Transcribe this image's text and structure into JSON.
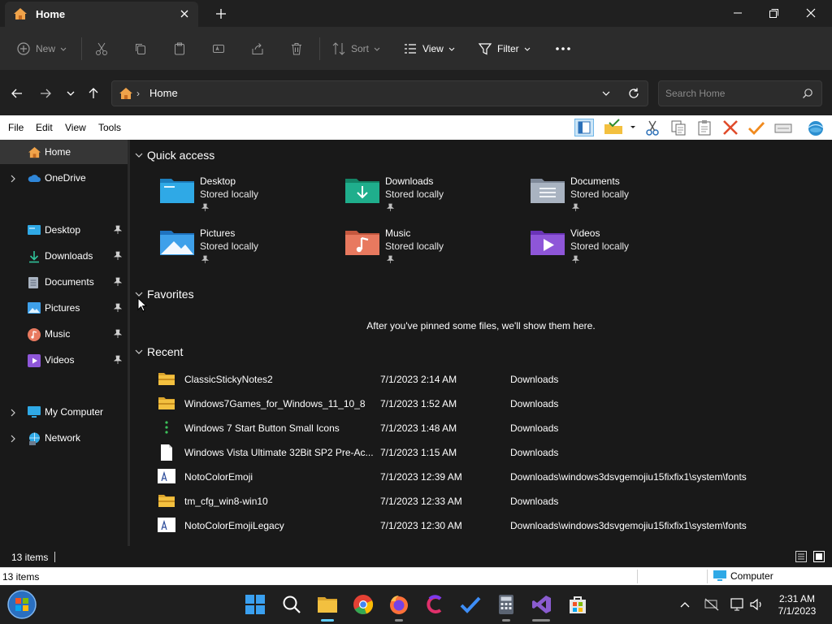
{
  "window": {
    "tab_title": "Home",
    "tab_icon": "home-icon"
  },
  "commandbar": {
    "new": "New",
    "sort": "Sort",
    "view": "View",
    "filter": "Filter",
    "more": "..."
  },
  "address": {
    "path": "Home",
    "search_placeholder": "Search Home"
  },
  "menubar": {
    "file": "File",
    "edit": "Edit",
    "view": "View",
    "tools": "Tools"
  },
  "nav": {
    "home": "Home",
    "onedrive": "OneDrive",
    "desktop": "Desktop",
    "downloads": "Downloads",
    "documents": "Documents",
    "pictures": "Pictures",
    "music": "Music",
    "videos": "Videos",
    "my_computer": "My Computer",
    "network": "Network"
  },
  "sections": {
    "quick_access": "Quick access",
    "favorites": "Favorites",
    "recent": "Recent",
    "favorites_empty": "After you've pinned some files, we'll show them here."
  },
  "quick_access": [
    {
      "name": "Desktop",
      "status": "Stored locally",
      "color": "#2fa9e6"
    },
    {
      "name": "Downloads",
      "status": "Stored locally",
      "color": "#1fae8c"
    },
    {
      "name": "Documents",
      "status": "Stored locally",
      "color": "#a9b3c1"
    },
    {
      "name": "Pictures",
      "status": "Stored locally",
      "color": "#3ea0ea"
    },
    {
      "name": "Music",
      "status": "Stored locally",
      "color": "#e8795f"
    },
    {
      "name": "Videos",
      "status": "Stored locally",
      "color": "#8e56d8"
    }
  ],
  "recent": [
    {
      "name": "ClassicStickyNotes2",
      "date": "7/1/2023 2:14 AM",
      "location": "Downloads",
      "icon": "folder-zip-icon"
    },
    {
      "name": "Windows7Games_for_Windows_11_10_8",
      "date": "7/1/2023 1:52 AM",
      "location": "Downloads",
      "icon": "folder-zip-icon"
    },
    {
      "name": "Windows 7 Start Button Small Icons",
      "date": "7/1/2023 1:48 AM",
      "location": "Downloads",
      "icon": "app-icon"
    },
    {
      "name": "Windows Vista Ultimate 32Bit SP2 Pre-Ac...",
      "date": "7/1/2023 1:15 AM",
      "location": "Downloads",
      "icon": "blank-file-icon"
    },
    {
      "name": "NotoColorEmoji",
      "date": "7/1/2023 12:39 AM",
      "location": "Downloads\\windows3dsvgemojiu15fixfix1\\system\\fonts",
      "icon": "font-file-icon"
    },
    {
      "name": "tm_cfg_win8-win10",
      "date": "7/1/2023 12:33 AM",
      "location": "Downloads",
      "icon": "folder-zip-icon"
    },
    {
      "name": "NotoColorEmojiLegacy",
      "date": "7/1/2023 12:30 AM",
      "location": "Downloads\\windows3dsvgemojiu15fixfix1\\system\\fonts",
      "icon": "font-file-icon"
    }
  ],
  "status": {
    "item_count": "13 items",
    "classic_count": "13 items",
    "zone": "Computer"
  },
  "taskbar": {
    "time": "2:31 AM",
    "date": "7/1/2023"
  },
  "colors": {
    "folder_yellow": "#f3c03f",
    "accent_blue": "#3a96dd",
    "dark_bg": "#191919"
  }
}
